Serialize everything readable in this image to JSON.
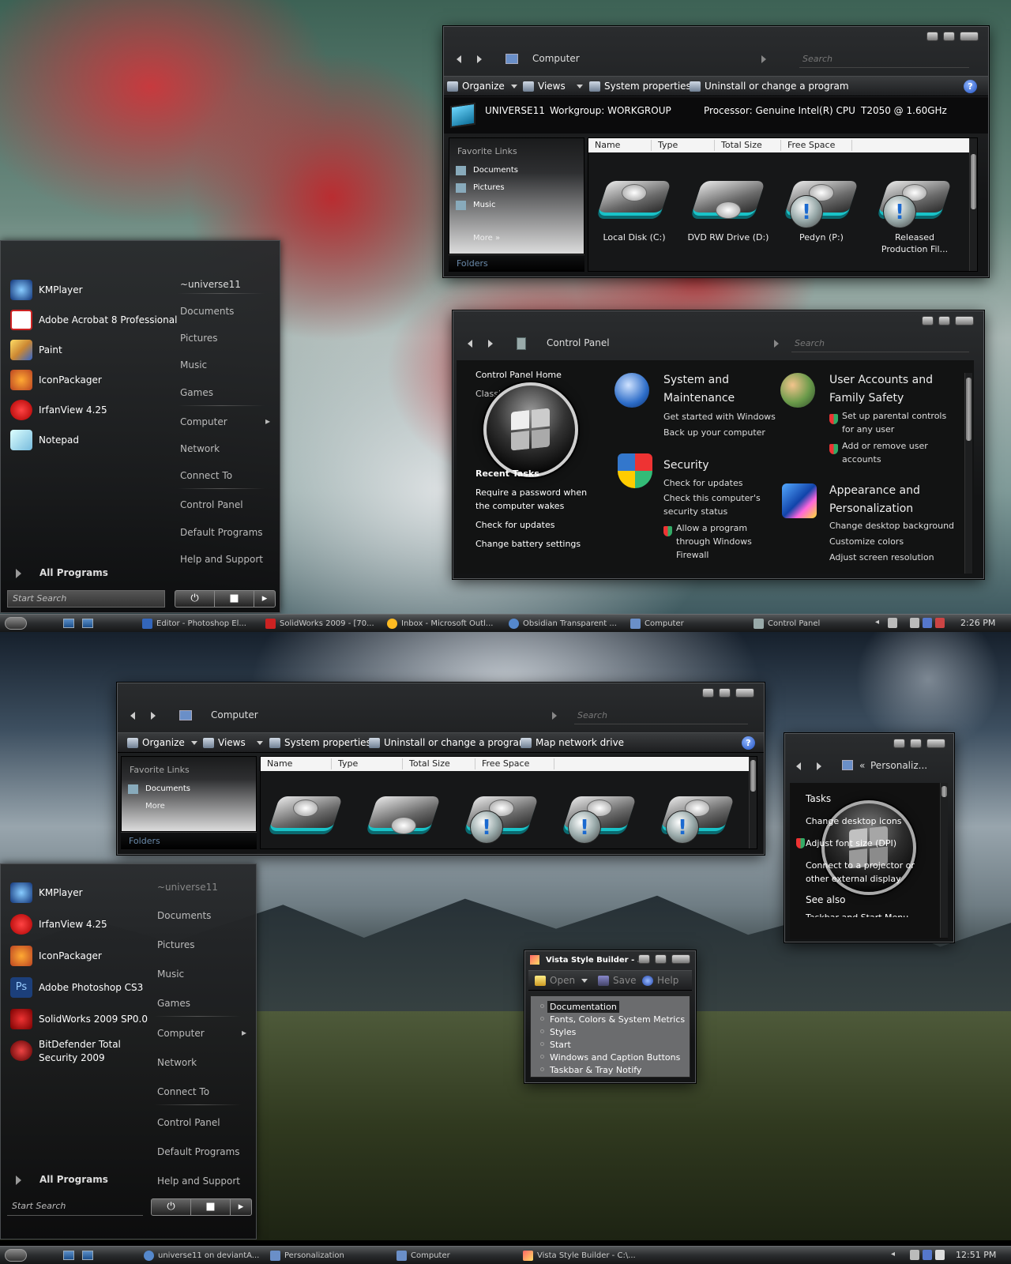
{
  "top": {
    "computer_window": {
      "breadcrumb": "Computer",
      "search_placeholder": "Search",
      "toolbar": {
        "organize": "Organize",
        "views": "Views",
        "system_properties": "System properties",
        "uninstall": "Uninstall or change a program"
      },
      "info": {
        "name": "UNIVERSE11",
        "workgroup": "Workgroup: WORKGROUP",
        "processor": "Processor: Genuine Intel(R) CPU",
        "cpu_model": "T2050  @ 1.60GHz"
      },
      "favorite_links_header": "Favorite Links",
      "favorite_links": [
        "Documents",
        "Pictures",
        "Music"
      ],
      "more_label": "More",
      "folders_label": "Folders",
      "columns": [
        "Name",
        "Type",
        "Total Size",
        "Free Space"
      ],
      "drives": [
        "Local Disk (C:)",
        "DVD RW Drive (D:)",
        "Pedyn  (P:)",
        "Released Production Fil..."
      ]
    },
    "control_panel": {
      "breadcrumb": "Control Panel",
      "search_placeholder": "Search",
      "home": "Control Panel Home",
      "classic": "Classic View",
      "recent_tasks_header": "Recent Tasks",
      "recent_tasks": [
        "Require a password when the computer wakes",
        "Check for updates",
        "Change battery settings"
      ],
      "categories": [
        {
          "title": "System and Maintenance",
          "links": [
            "Get started with Windows",
            "Back up your computer"
          ]
        },
        {
          "title": "Security",
          "links": [
            "Check for updates",
            "Check this computer's security status",
            "Allow a program through Windows Firewall"
          ]
        },
        {
          "title": "User Accounts and Family Safety",
          "links": [
            "Set up parental controls for any user",
            "Add or remove user accounts"
          ]
        },
        {
          "title": "Appearance and Personalization",
          "links": [
            "Change desktop background",
            "Customize colors",
            "Adjust screen resolution"
          ]
        }
      ]
    },
    "start_menu": {
      "programs": [
        "KMPlayer",
        "Adobe Acrobat 8 Professional",
        "Paint",
        "IconPackager",
        "IrfanView 4.25",
        "Notepad"
      ],
      "right": [
        "~universe11",
        "Documents",
        "Pictures",
        "Music",
        "Games",
        "Computer",
        "Network",
        "Connect To",
        "Control Panel",
        "Default Programs",
        "Help and Support"
      ],
      "all_programs": "All Programs",
      "search_placeholder": "Start Search"
    },
    "taskbar": {
      "buttons": [
        "Editor - Photoshop El...",
        "SolidWorks 2009 - [70...",
        "Inbox - Microsoft Outl...",
        "Obsidian Transparent ...",
        "Computer",
        "Control Panel"
      ],
      "clock": "2:26 PM"
    }
  },
  "bottom": {
    "computer_window": {
      "breadcrumb": "Computer",
      "search_placeholder": "Search",
      "toolbar": {
        "organize": "Organize",
        "views": "Views",
        "system_properties": "System properties",
        "uninstall": "Uninstall or change a program",
        "map_drive": "Map network drive"
      },
      "favorite_links_header": "Favorite Links",
      "favorite_links": [
        "Documents"
      ],
      "more_label": "More",
      "folders_label": "Folders",
      "columns": [
        "Name",
        "Type",
        "Total Size",
        "Free Space"
      ]
    },
    "personalization": {
      "breadcrumb": "Personaliz...",
      "tasks_header": "Tasks",
      "tasks": [
        "Change desktop icons",
        "Adjust font size (DPI)",
        "Connect to a projector or other external display"
      ],
      "see_also": "See also",
      "see_also_item": "Taskbar and Start Menu"
    },
    "vista_style_builder": {
      "title": "Vista Style Builder - ...",
      "toolbar": {
        "open": "Open",
        "save": "Save",
        "help": "Help"
      },
      "tree": [
        "Documentation",
        "Fonts, Colors & System Metrics",
        "Styles",
        "Start",
        "Windows and Caption Buttons",
        "Taskbar & Tray Notify"
      ]
    },
    "start_menu": {
      "programs": [
        "KMPlayer",
        "IrfanView 4.25",
        "IconPackager",
        "Adobe Photoshop CS3",
        "SolidWorks 2009 SP0.0",
        "BitDefender Total Security 2009"
      ],
      "right": [
        "~universe11",
        "Documents",
        "Pictures",
        "Music",
        "Games",
        "Computer",
        "Network",
        "Connect To",
        "Control Panel",
        "Default Programs",
        "Help and Support"
      ],
      "all_programs": "All Programs",
      "search_placeholder": "Start Search"
    },
    "taskbar": {
      "buttons": [
        "universe11 on deviantA...",
        "Personalization",
        "Computer",
        "Vista Style Builder - C:\\..."
      ],
      "clock": "12:51 PM"
    }
  },
  "colors": {
    "accent_cyan": "#19c3c8",
    "link_blue": "#6a8aaa",
    "panel_dark": "#161718"
  }
}
